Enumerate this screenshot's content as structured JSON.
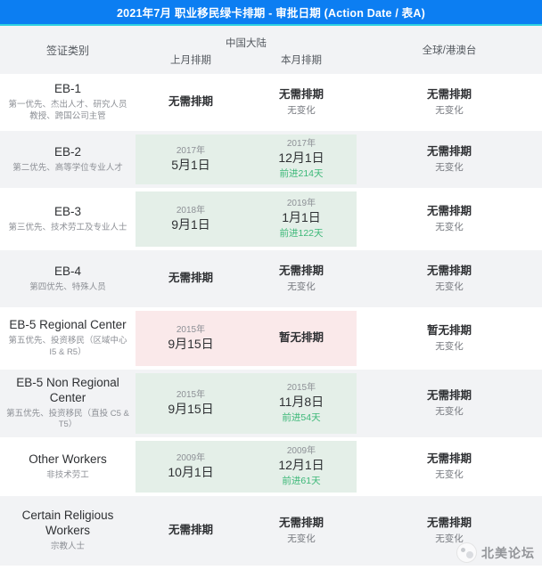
{
  "header": {
    "title": "2021年7月 职业移民绿卡排期 - 审批日期 (Action Date / 表A)",
    "accent_color": "#0c7ef2",
    "rule_color": "#2ed0e0"
  },
  "columns": {
    "category": "签证类别",
    "china_group": "中国大陆",
    "previous_month": "上月排期",
    "current_month": "本月排期",
    "worldwide": "全球/港澳台"
  },
  "colors": {
    "advance_green": "#3cb878",
    "highlight_green": "#e4efe8",
    "highlight_pink": "#fae9ea",
    "row_alt": "#f2f3f5"
  },
  "rows": [
    {
      "category": "EB-1",
      "category_sub": "第一优先、杰出人才、研究人员教授、跨国公司主管",
      "highlight": "none",
      "prev": {
        "year": "",
        "day": "无需排期",
        "style": "plain"
      },
      "curr": {
        "year": "",
        "day": "无需排期",
        "style": "plain",
        "note": "无变化",
        "note_type": "nochange"
      },
      "world": {
        "value": "无需排期",
        "note": "无变化"
      }
    },
    {
      "category": "EB-2",
      "category_sub": "第二优先、高等学位专业人才",
      "highlight": "green",
      "prev": {
        "year": "2017年",
        "day": "5月1日",
        "style": "date"
      },
      "curr": {
        "year": "2017年",
        "day": "12月1日",
        "style": "date",
        "note": "前进214天",
        "note_type": "advance"
      },
      "world": {
        "value": "无需排期",
        "note": "无变化"
      }
    },
    {
      "category": "EB-3",
      "category_sub": "第三优先、技术劳工及专业人士",
      "highlight": "green",
      "prev": {
        "year": "2018年",
        "day": "9月1日",
        "style": "date"
      },
      "curr": {
        "year": "2019年",
        "day": "1月1日",
        "style": "date",
        "note": "前进122天",
        "note_type": "advance"
      },
      "world": {
        "value": "无需排期",
        "note": "无变化"
      }
    },
    {
      "category": "EB-4",
      "category_sub": "第四优先、特殊人员",
      "highlight": "none",
      "prev": {
        "year": "",
        "day": "无需排期",
        "style": "plain"
      },
      "curr": {
        "year": "",
        "day": "无需排期",
        "style": "plain",
        "note": "无变化",
        "note_type": "nochange"
      },
      "world": {
        "value": "无需排期",
        "note": "无变化"
      }
    },
    {
      "category": "EB-5 Regional Center",
      "category_sub": "第五优先、投资移民（区域中心 I5 & R5）",
      "highlight": "pink",
      "prev": {
        "year": "2015年",
        "day": "9月15日",
        "style": "date"
      },
      "curr": {
        "year": "",
        "day": "暂无排期",
        "style": "plain",
        "note": "",
        "note_type": "none"
      },
      "world": {
        "value": "暂无排期",
        "note": "无变化"
      }
    },
    {
      "category": "EB-5 Non Regional Center",
      "category_sub": "第五优先、投资移民（直投 C5 & T5）",
      "highlight": "green",
      "prev": {
        "year": "2015年",
        "day": "9月15日",
        "style": "date"
      },
      "curr": {
        "year": "2015年",
        "day": "11月8日",
        "style": "date",
        "note": "前进54天",
        "note_type": "advance"
      },
      "world": {
        "value": "无需排期",
        "note": "无变化"
      }
    },
    {
      "category": "Other Workers",
      "category_sub": "非技术劳工",
      "highlight": "green",
      "prev": {
        "year": "2009年",
        "day": "10月1日",
        "style": "date"
      },
      "curr": {
        "year": "2009年",
        "day": "12月1日",
        "style": "date",
        "note": "前进61天",
        "note_type": "advance"
      },
      "world": {
        "value": "无需排期",
        "note": "无变化"
      }
    },
    {
      "category": "Certain Religious Workers",
      "category_sub": "宗教人士",
      "highlight": "none",
      "prev": {
        "year": "",
        "day": "无需排期",
        "style": "plain"
      },
      "curr": {
        "year": "",
        "day": "无需排期",
        "style": "plain",
        "note": "无变化",
        "note_type": "nochange"
      },
      "world": {
        "value": "无需排期",
        "note": "无变化"
      }
    }
  ],
  "watermark": {
    "text": "北美论坛",
    "logo_icon": "forum-logo-icon"
  }
}
